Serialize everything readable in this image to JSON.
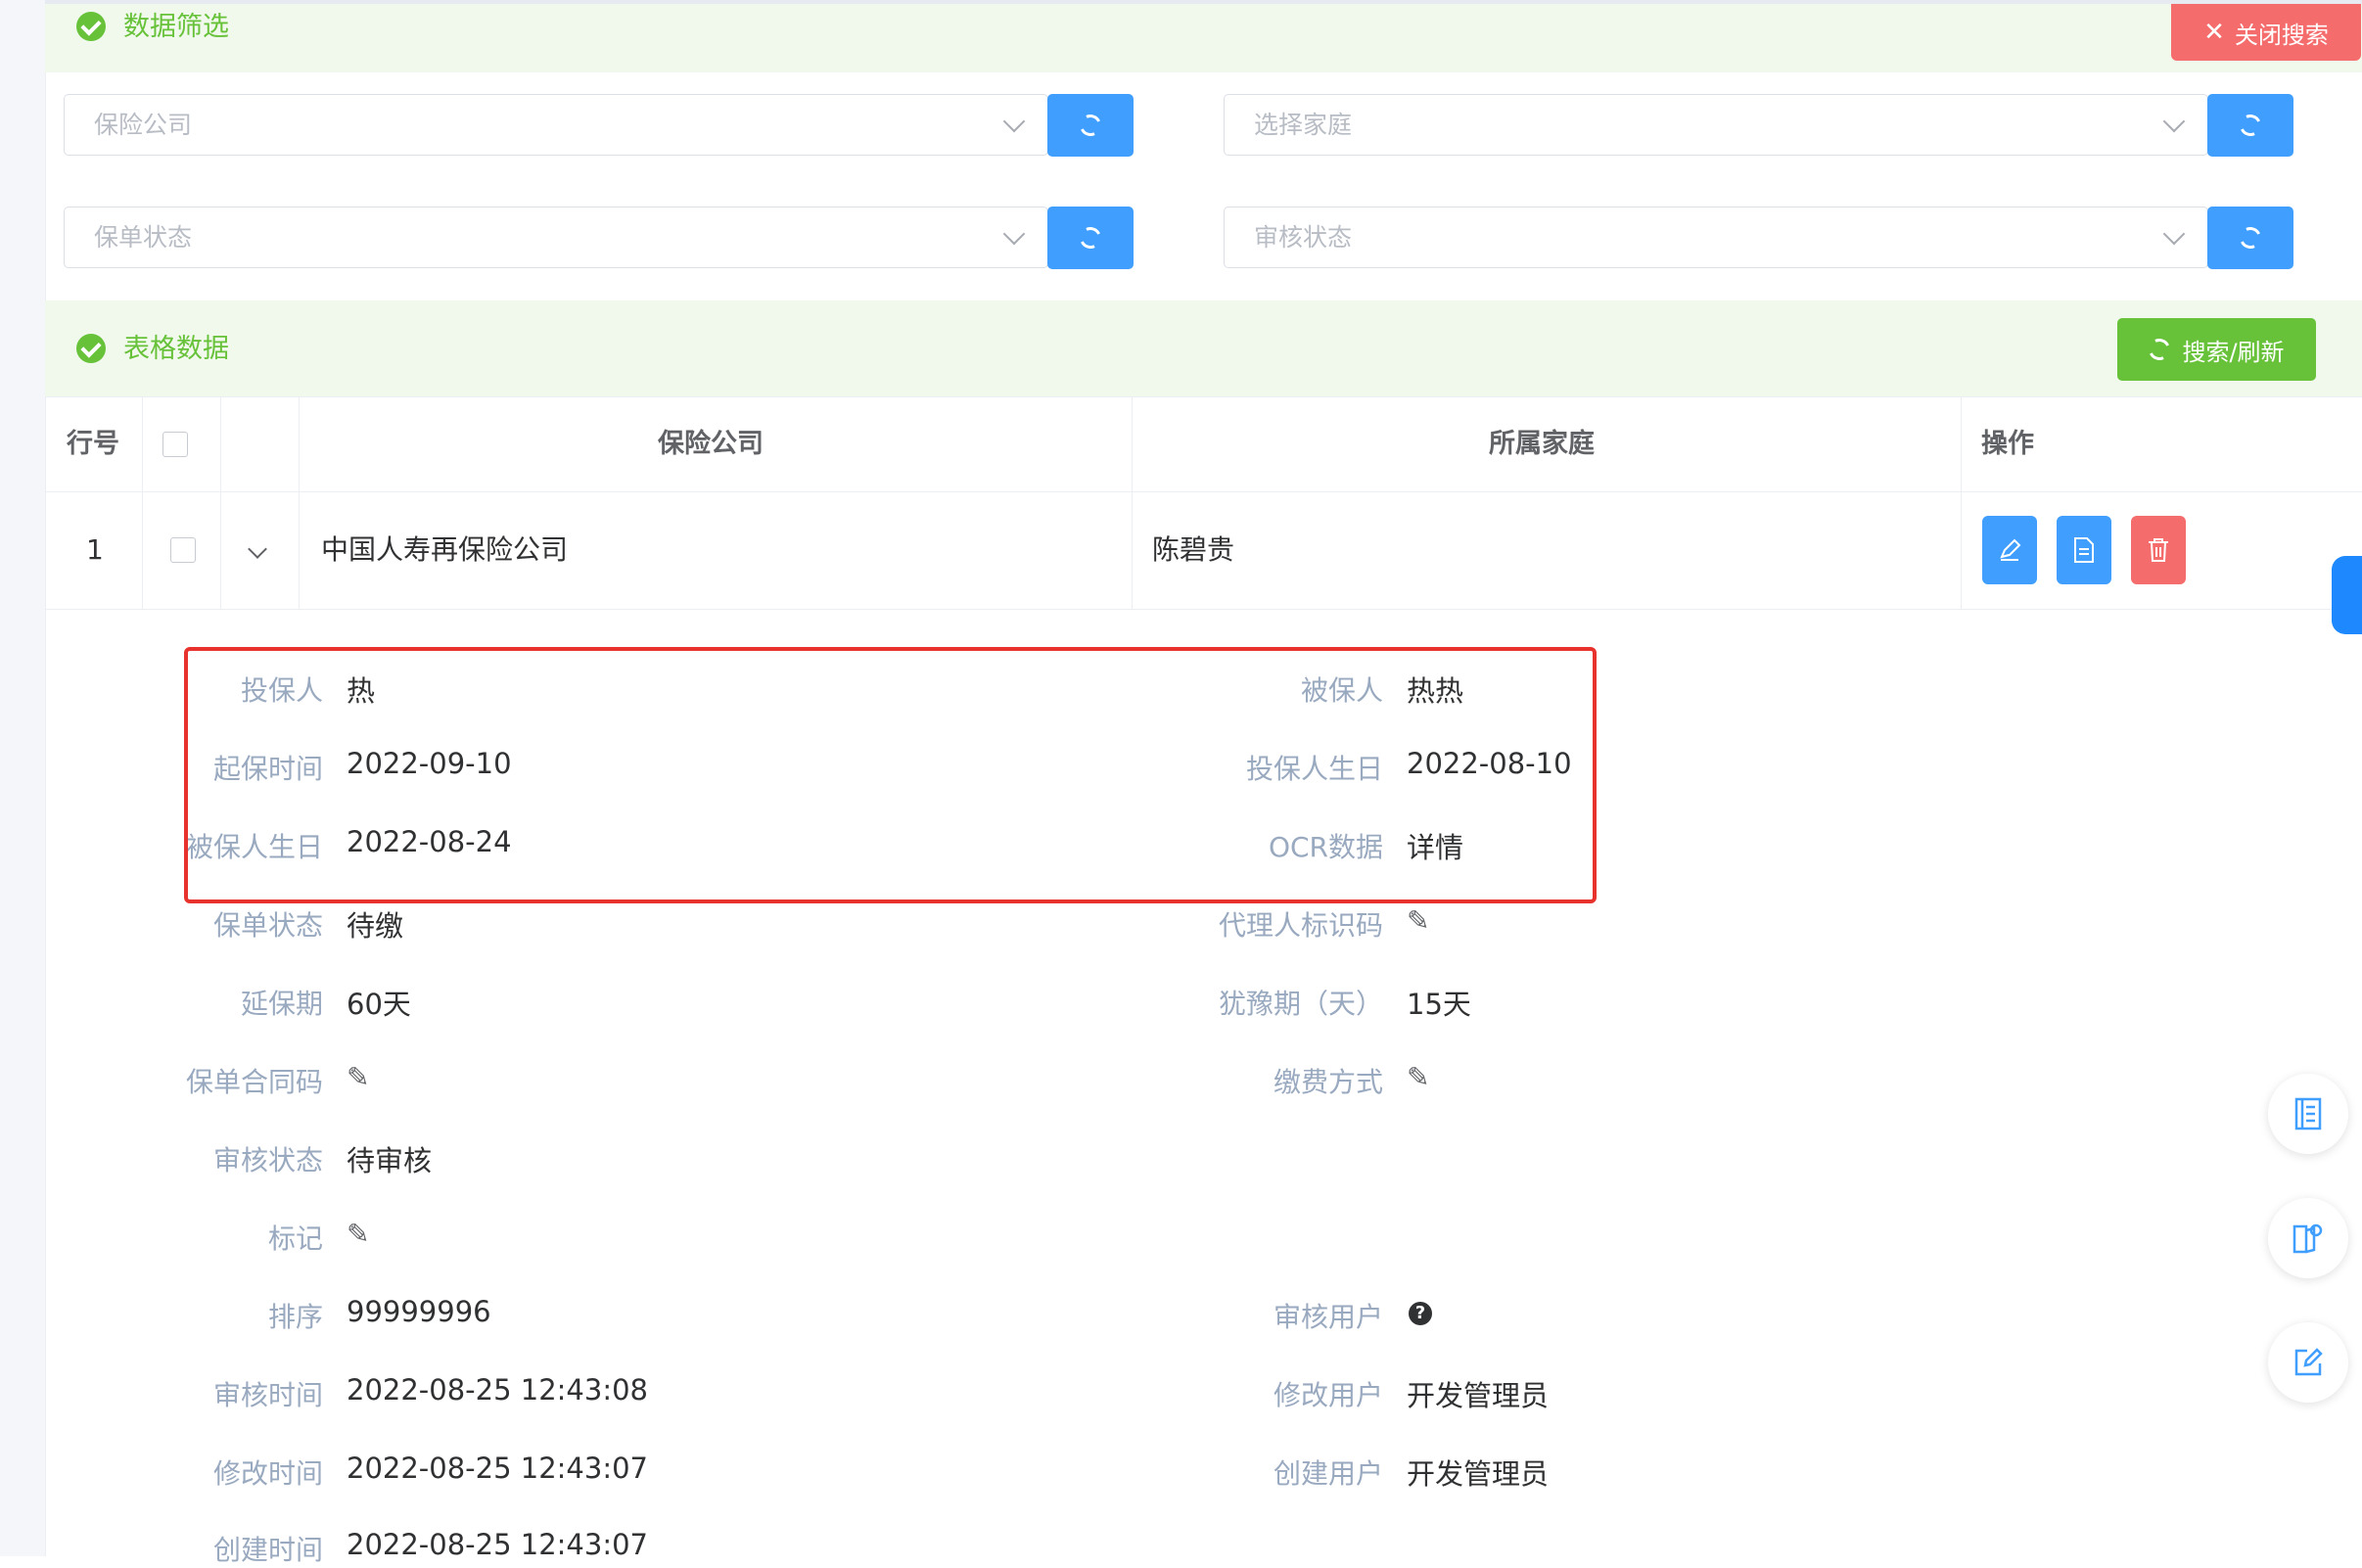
{
  "filter": {
    "title": "数据筛选",
    "close_label": "关闭搜索",
    "selects": [
      {
        "placeholder": "保险公司"
      },
      {
        "placeholder": "选择家庭"
      },
      {
        "placeholder": "保单状态"
      },
      {
        "placeholder": "审核状态"
      }
    ]
  },
  "table_section": {
    "title": "表格数据",
    "search_label": "搜索/刷新"
  },
  "table": {
    "headers": {
      "row_no": "行号",
      "company": "保险公司",
      "family": "所属家庭",
      "ops": "操作"
    },
    "rows": [
      {
        "row_no": "1",
        "company": "中国人寿再保险公司",
        "family": "陈碧贵"
      }
    ]
  },
  "detail": {
    "left": [
      {
        "label": "投保人",
        "value": "热"
      },
      {
        "label": "起保时间",
        "value": "2022-09-10"
      },
      {
        "label": "被保人生日",
        "value": "2022-08-24"
      },
      {
        "label": "保单状态",
        "value": "待缴"
      },
      {
        "label": "延保期",
        "value": "60天"
      },
      {
        "label": "保单合同码",
        "value": ""
      },
      {
        "label": "审核状态",
        "value": "待审核"
      },
      {
        "label": "标记",
        "value": ""
      },
      {
        "label": "排序",
        "value": "99999996"
      },
      {
        "label": "审核时间",
        "value": "2022-08-25 12:43:08"
      },
      {
        "label": "修改时间",
        "value": "2022-08-25 12:43:07"
      },
      {
        "label": "创建时间",
        "value": "2022-08-25 12:43:07"
      }
    ],
    "right": [
      {
        "label": "被保人",
        "value": "热热"
      },
      {
        "label": "投保人生日",
        "value": "2022-08-10"
      },
      {
        "label": "OCR数据",
        "value": "详情"
      },
      {
        "label": "代理人标识码",
        "value": ""
      },
      {
        "label": "犹豫期（天）",
        "value": "15天"
      },
      {
        "label": "缴费方式",
        "value": ""
      },
      {
        "label": "审核用户",
        "value": ""
      },
      {
        "label": "修改用户",
        "value": "开发管理员"
      },
      {
        "label": "创建用户",
        "value": "开发管理员"
      }
    ]
  },
  "colors": {
    "success": "#67c23a",
    "primary": "#409eff",
    "danger": "#f56c6c",
    "highlight_box": "#e8322e"
  }
}
